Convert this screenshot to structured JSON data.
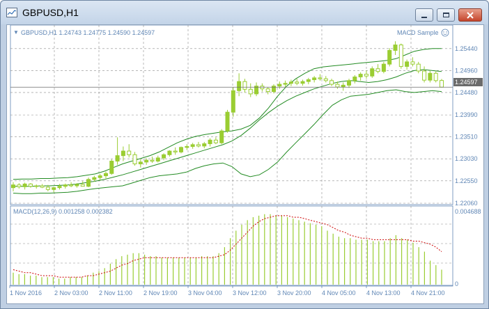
{
  "window": {
    "title": "GBPUSD,H1",
    "title_icon": "chart-window-icon",
    "controls": [
      "minimize-icon",
      "restore-icon",
      "close-icon"
    ]
  },
  "colors": {
    "candle": "#9acd32",
    "band": "#228b22",
    "signal": "#cc0000",
    "grid": "#8c8c8c",
    "text": "#5f86b5",
    "price_line": "#6b6b6b"
  },
  "header": {
    "symbol_info": "GBPUSD,H1  1.24743 1.24775 1.24590 1.24597",
    "indicator_name": "MACD Sample",
    "indicator_icon": "smiley-icon"
  },
  "price_axis": {
    "ticks": [
      "1.25440",
      "1.24960",
      "1.24480",
      "1.23990",
      "1.23510",
      "1.23030",
      "1.22550",
      "1.22060"
    ],
    "current_price": "1.24597"
  },
  "macd_panel": {
    "label": "MACD(12,26,9) 0.001258 0.002382",
    "max_label": "0.004688",
    "zero_label": "0"
  },
  "time_axis": {
    "labels": [
      "1 Nov 2016",
      "2 Nov 03:00",
      "2 Nov 11:00",
      "2 Nov 19:00",
      "3 Nov 04:00",
      "3 Nov 12:00",
      "3 Nov 20:00",
      "4 Nov 05:00",
      "4 Nov 13:00",
      "4 Nov 21:00"
    ]
  },
  "chart_data": {
    "type": "candlestick",
    "symbol": "GBPUSD",
    "timeframe": "H1",
    "last_bar": {
      "open": 1.24743,
      "high": 1.24775,
      "low": 1.2459,
      "close": 1.24597
    },
    "ylim": [
      1.2206,
      1.2565
    ],
    "candles": [
      [
        1.224,
        1.2252,
        1.2232,
        1.2246
      ],
      [
        1.2246,
        1.225,
        1.2238,
        1.2242
      ],
      [
        1.2242,
        1.2251,
        1.2236,
        1.2248
      ],
      [
        1.2248,
        1.225,
        1.224,
        1.2243
      ],
      [
        1.2243,
        1.2247,
        1.2238,
        1.2244
      ],
      [
        1.2244,
        1.2248,
        1.2239,
        1.2241
      ],
      [
        1.2241,
        1.2246,
        1.2232,
        1.2236
      ],
      [
        1.2236,
        1.2242,
        1.223,
        1.224
      ],
      [
        1.224,
        1.2248,
        1.2236,
        1.2243
      ],
      [
        1.2243,
        1.2249,
        1.2238,
        1.2246
      ],
      [
        1.2246,
        1.2252,
        1.2241,
        1.2244
      ],
      [
        1.2244,
        1.225,
        1.224,
        1.2247
      ],
      [
        1.2247,
        1.2254,
        1.2243,
        1.2243
      ],
      [
        1.2243,
        1.2262,
        1.2241,
        1.2258
      ],
      [
        1.2258,
        1.2266,
        1.2253,
        1.2262
      ],
      [
        1.2262,
        1.227,
        1.2256,
        1.2266
      ],
      [
        1.2266,
        1.2275,
        1.226,
        1.2271
      ],
      [
        1.2271,
        1.2302,
        1.2268,
        1.2298
      ],
      [
        1.2298,
        1.235,
        1.229,
        1.231
      ],
      [
        1.231,
        1.233,
        1.2298,
        1.232
      ],
      [
        1.232,
        1.2335,
        1.2306,
        1.2312
      ],
      [
        1.2312,
        1.2318,
        1.2288,
        1.2292
      ],
      [
        1.2292,
        1.2302,
        1.2284,
        1.2296
      ],
      [
        1.2296,
        1.2304,
        1.229,
        1.23
      ],
      [
        1.23,
        1.2308,
        1.2294,
        1.2298
      ],
      [
        1.2298,
        1.231,
        1.2295,
        1.2305
      ],
      [
        1.2305,
        1.2315,
        1.23,
        1.2312
      ],
      [
        1.2312,
        1.2322,
        1.2308,
        1.232
      ],
      [
        1.232,
        1.2328,
        1.2312,
        1.2318
      ],
      [
        1.2318,
        1.233,
        1.2315,
        1.2328
      ],
      [
        1.2328,
        1.2335,
        1.2322,
        1.233
      ],
      [
        1.233,
        1.2338,
        1.2325,
        1.2334
      ],
      [
        1.2334,
        1.234,
        1.2328,
        1.2331
      ],
      [
        1.2331,
        1.234,
        1.2326,
        1.2336
      ],
      [
        1.2336,
        1.2348,
        1.233,
        1.2344
      ],
      [
        1.2344,
        1.235,
        1.2335,
        1.2338
      ],
      [
        1.2338,
        1.2368,
        1.2335,
        1.2364
      ],
      [
        1.2364,
        1.241,
        1.236,
        1.2405
      ],
      [
        1.2405,
        1.246,
        1.2395,
        1.2452
      ],
      [
        1.2452,
        1.249,
        1.244,
        1.2472
      ],
      [
        1.2472,
        1.2478,
        1.2448,
        1.2455
      ],
      [
        1.2455,
        1.2468,
        1.2438,
        1.2445
      ],
      [
        1.2445,
        1.247,
        1.244,
        1.2462
      ],
      [
        1.2462,
        1.2468,
        1.245,
        1.2456
      ],
      [
        1.2456,
        1.246,
        1.2444,
        1.245
      ],
      [
        1.245,
        1.2466,
        1.2446,
        1.2462
      ],
      [
        1.2462,
        1.2472,
        1.2456,
        1.2466
      ],
      [
        1.2466,
        1.2474,
        1.246,
        1.2468
      ],
      [
        1.2468,
        1.2476,
        1.2462,
        1.2471
      ],
      [
        1.2471,
        1.2478,
        1.2464,
        1.2468
      ],
      [
        1.2468,
        1.2476,
        1.2463,
        1.2472
      ],
      [
        1.2472,
        1.248,
        1.2466,
        1.2476
      ],
      [
        1.2476,
        1.2484,
        1.247,
        1.248
      ],
      [
        1.248,
        1.2488,
        1.2474,
        1.2478
      ],
      [
        1.2478,
        1.2484,
        1.247,
        1.2474
      ],
      [
        1.2474,
        1.2478,
        1.2462,
        1.2466
      ],
      [
        1.2466,
        1.2472,
        1.2456,
        1.246
      ],
      [
        1.246,
        1.247,
        1.2452,
        1.2464
      ],
      [
        1.2464,
        1.2478,
        1.2458,
        1.2474
      ],
      [
        1.2474,
        1.2486,
        1.2468,
        1.2482
      ],
      [
        1.2482,
        1.2492,
        1.2474,
        1.2488
      ],
      [
        1.2488,
        1.2496,
        1.2478,
        1.2484
      ],
      [
        1.2484,
        1.2505,
        1.248,
        1.25
      ],
      [
        1.25,
        1.251,
        1.249,
        1.2494
      ],
      [
        1.2494,
        1.2515,
        1.249,
        1.251
      ],
      [
        1.251,
        1.2545,
        1.2505,
        1.254
      ],
      [
        1.254,
        1.256,
        1.253,
        1.2552
      ],
      [
        1.2552,
        1.2555,
        1.25,
        1.2505
      ],
      [
        1.2505,
        1.252,
        1.2498,
        1.2515
      ],
      [
        1.2515,
        1.2525,
        1.2505,
        1.251
      ],
      [
        1.251,
        1.2515,
        1.249,
        1.2495
      ],
      [
        1.2495,
        1.2505,
        1.247,
        1.2475
      ],
      [
        1.2475,
        1.2495,
        1.247,
        1.249
      ],
      [
        1.249,
        1.2494,
        1.247,
        1.2474
      ],
      [
        1.24743,
        1.24775,
        1.2459,
        1.24597
      ]
    ],
    "bollinger": {
      "upper": [
        1.2258,
        1.2259,
        1.2259,
        1.226,
        1.226,
        1.2261,
        1.2262,
        1.2264,
        1.2267,
        1.227,
        1.2276,
        1.2284,
        1.2292,
        1.2298,
        1.2304,
        1.231,
        1.2318,
        1.2328,
        1.2338,
        1.2346,
        1.2352,
        1.2356,
        1.2359,
        1.2362,
        1.2364,
        1.2368,
        1.2376,
        1.2392,
        1.2414,
        1.244,
        1.2462,
        1.2478,
        1.249,
        1.25,
        1.2504,
        1.2506,
        1.2508,
        1.251,
        1.2512,
        1.2514,
        1.2516,
        1.2518,
        1.2522,
        1.253,
        1.2538,
        1.2542,
        1.2544,
        1.2544
      ],
      "middle": [
        1.2243,
        1.2243,
        1.2243,
        1.2244,
        1.2244,
        1.2245,
        1.2246,
        1.2248,
        1.2251,
        1.2254,
        1.2258,
        1.2263,
        1.2268,
        1.2274,
        1.228,
        1.2286,
        1.2292,
        1.2298,
        1.2304,
        1.231,
        1.2316,
        1.2322,
        1.2328,
        1.2334,
        1.2342,
        1.2354,
        1.237,
        1.2388,
        1.2404,
        1.2418,
        1.243,
        1.244,
        1.2448,
        1.2456,
        1.2462,
        1.2468,
        1.2472,
        1.2474,
        1.2472,
        1.247,
        1.2472,
        1.2476,
        1.2482,
        1.249,
        1.2496,
        1.2498,
        1.2496,
        1.2494
      ],
      "lower": [
        1.2228,
        1.2227,
        1.2227,
        1.2228,
        1.2228,
        1.2229,
        1.223,
        1.2232,
        1.2235,
        1.2238,
        1.224,
        1.2242,
        1.2244,
        1.225,
        1.2256,
        1.2262,
        1.2266,
        1.2268,
        1.227,
        1.2274,
        1.2282,
        1.2288,
        1.2292,
        1.2294,
        1.2286,
        1.227,
        1.2264,
        1.2268,
        1.228,
        1.2296,
        1.2318,
        1.2338,
        1.2358,
        1.2378,
        1.24,
        1.242,
        1.2432,
        1.244,
        1.2442,
        1.2444,
        1.2448,
        1.2452,
        1.2454,
        1.245,
        1.2448,
        1.245,
        1.2452,
        1.245
      ]
    },
    "macd": {
      "ylim": [
        0,
        0.004688
      ],
      "histogram": [
        0.0008,
        0.0007,
        0.0007,
        0.0006,
        0.0006,
        0.0005,
        0.0005,
        0.0005,
        0.0004,
        0.0004,
        0.0005,
        0.0005,
        0.0005,
        0.0006,
        0.0008,
        0.0009,
        0.0011,
        0.0014,
        0.0017,
        0.0019,
        0.002,
        0.0021,
        0.0021,
        0.002,
        0.0019,
        0.0019,
        0.0018,
        0.0018,
        0.0018,
        0.0018,
        0.0018,
        0.0018,
        0.0018,
        0.0019,
        0.0019,
        0.0019,
        0.0021,
        0.0025,
        0.0031,
        0.0036,
        0.004,
        0.0043,
        0.0045,
        0.0046,
        0.0047,
        0.0047,
        0.0046,
        0.0046,
        0.0045,
        0.0044,
        0.0043,
        0.0042,
        0.0041,
        0.004,
        0.0039,
        0.0036,
        0.0034,
        0.0032,
        0.0031,
        0.0031,
        0.003,
        0.003,
        0.003,
        0.0029,
        0.0029,
        0.0029,
        0.0031,
        0.0033,
        0.0031,
        0.003,
        0.0028,
        0.0025,
        0.0022,
        0.0016,
        0.0013,
        0.001
      ],
      "signal": [
        0.001,
        0.0009,
        0.0008,
        0.0008,
        0.0007,
        0.0006,
        0.0006,
        0.0006,
        0.0005,
        0.0005,
        0.0005,
        0.0005,
        0.0005,
        0.0006,
        0.0006,
        0.0007,
        0.0008,
        0.0009,
        0.0011,
        0.0013,
        0.0014,
        0.0016,
        0.0017,
        0.0018,
        0.0018,
        0.0018,
        0.0018,
        0.0018,
        0.0018,
        0.0018,
        0.0018,
        0.0018,
        0.0018,
        0.0018,
        0.0018,
        0.0018,
        0.0019,
        0.002,
        0.0023,
        0.0027,
        0.0031,
        0.0035,
        0.0039,
        0.0042,
        0.0044,
        0.0045,
        0.0046,
        0.0046,
        0.0046,
        0.0045,
        0.0045,
        0.0044,
        0.0043,
        0.0042,
        0.0041,
        0.004,
        0.0038,
        0.0036,
        0.0035,
        0.0033,
        0.0032,
        0.0031,
        0.0031,
        0.003,
        0.003,
        0.003,
        0.003,
        0.003,
        0.003,
        0.003,
        0.0029,
        0.0029,
        0.0028,
        0.0027,
        0.0025,
        0.0022
      ]
    }
  }
}
